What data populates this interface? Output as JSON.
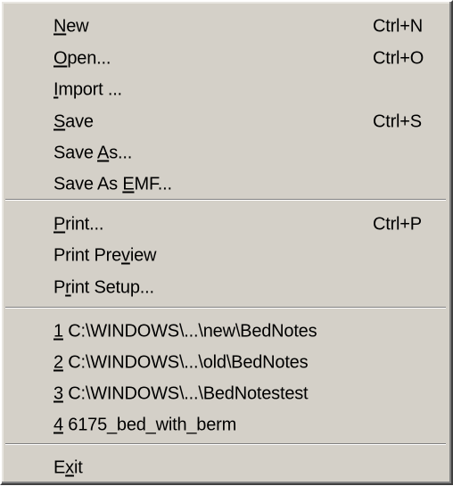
{
  "menu": {
    "groups": [
      {
        "items": [
          {
            "pre": "",
            "key": "N",
            "post": "ew",
            "shortcut": "Ctrl+N"
          },
          {
            "pre": "",
            "key": "O",
            "post": "pen...",
            "shortcut": "Ctrl+O"
          },
          {
            "pre": "",
            "key": "I",
            "post": "mport ...",
            "shortcut": ""
          },
          {
            "pre": "",
            "key": "S",
            "post": "ave",
            "shortcut": "Ctrl+S"
          },
          {
            "pre": "Save ",
            "key": "A",
            "post": "s...",
            "shortcut": ""
          },
          {
            "pre": "Save As ",
            "key": "E",
            "post": "MF...",
            "shortcut": ""
          }
        ]
      },
      {
        "items": [
          {
            "pre": "",
            "key": "P",
            "post": "rint...",
            "shortcut": "Ctrl+P"
          },
          {
            "pre": "Print Pre",
            "key": "v",
            "post": "iew",
            "shortcut": ""
          },
          {
            "pre": "P",
            "key": "r",
            "post": "int Setup...",
            "shortcut": ""
          }
        ]
      },
      {
        "items": [
          {
            "pre": "",
            "key": "1",
            "post": " C:\\WINDOWS\\...\\new\\BedNotes",
            "shortcut": ""
          },
          {
            "pre": "",
            "key": "2",
            "post": " C:\\WINDOWS\\...\\old\\BedNotes",
            "shortcut": ""
          },
          {
            "pre": "",
            "key": "3",
            "post": " C:\\WINDOWS\\...\\BedNotestest",
            "shortcut": ""
          },
          {
            "pre": "",
            "key": "4",
            "post": " 6175_bed_with_berm",
            "shortcut": ""
          }
        ]
      },
      {
        "items": [
          {
            "pre": "E",
            "key": "x",
            "post": "it",
            "shortcut": ""
          }
        ]
      }
    ]
  }
}
